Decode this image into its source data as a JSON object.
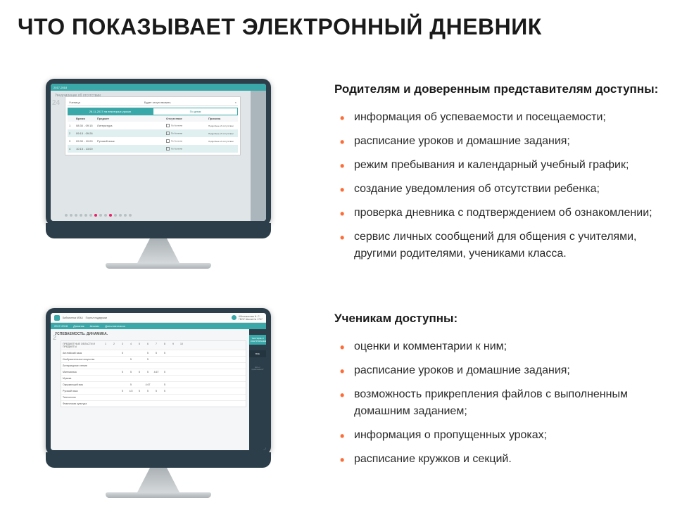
{
  "page_title": "ЧТО ПОКАЗЫВАЕТ ЭЛЕКТРОННЫЙ ДНЕВНИК",
  "section1": {
    "title": "Родителям и доверенным представителям доступны:",
    "items": [
      "информация об успеваемости и посещаемости;",
      "расписание уроков и домашние задания;",
      "режим пребывания и календарный учебный график;",
      "создание уведомления об отсутствии ребенка;",
      "проверка дневника с подтверждением об ознакомлении;",
      "сервис личных сообщений для общения с учителями, другими родителями, учениками класса."
    ],
    "app": {
      "year": "2017-2018",
      "bg_title": "Уведомление об отсутствии",
      "bg_num": "24",
      "modal_left": "Ученица",
      "modal_right": "Будет отсутствовать",
      "tab_active": "28.11.2017 на некоторых уроках",
      "tab_inactive": "По дням",
      "thead": [
        "",
        "Время",
        "Предмет",
        "Отсутствие",
        "Причина"
      ],
      "rows": [
        {
          "n": "1",
          "time": "08:30 - 09:15",
          "subj": "Литература",
          "cause": "Подробнее об отсутствии"
        },
        {
          "n": "2",
          "time": "09:15 - 09:26",
          "subj": "",
          "cause": "Подробнее об отсутствии"
        },
        {
          "n": "3",
          "time": "09:30 - 10:00",
          "subj": "Русский язык",
          "cause": "Подробнее об отсутствии"
        },
        {
          "n": "4",
          "time": "10:15 - 13:00",
          "subj": "",
          "cause": ""
        }
      ]
    }
  },
  "section2": {
    "title": "Ученикам доступны:",
    "items": [
      "оценки и комментарии к ним;",
      "расписание уроков и домашние задания;",
      "возможность прикрепления файлов с выполненным домашним заданием;",
      "информация о пропущенных уроках;",
      "расписание кружков и секций."
    ],
    "app": {
      "year": "2017-2018",
      "site": "Библиотека МЭШ",
      "support": "Портал поддержки",
      "user_name": "Абельмасова Н. С.",
      "user_school": "ГБОУ Школа № 1747",
      "nav": [
        "Дневник",
        "Анализ",
        "Дополнительно"
      ],
      "title": "УСПЕВАЕМОСТЬ. ДИНАМИКА.",
      "bg_num": "2",
      "col_label": "динамика по неделям",
      "first_col": "ПРЕДМЕТНЫЕ ОБЛАСТИ И ПРЕДМЕТЫ",
      "cols": [
        "1",
        "2",
        "3",
        "4",
        "5",
        "6",
        "7",
        "8",
        "9",
        "10"
      ],
      "sidebar_label1": "ТЕКУЩИЕ И КОНТРОЛЬНЫЕ",
      "sidebar_label2": "ВСЕ",
      "sidebar_label3": "Есть с примечанием?",
      "rows": [
        {
          "name": "Английский язык",
          "vals": [
            "",
            "",
            "5",
            "",
            "",
            "5",
            "5",
            "5",
            ""
          ]
        },
        {
          "name": "Изобразительное искусство",
          "vals": [
            "",
            "",
            "",
            "5",
            "",
            "5",
            "",
            "",
            ""
          ]
        },
        {
          "name": "Литературное чтение",
          "vals": [
            "",
            "",
            "",
            "",
            "",
            "",
            "",
            "",
            ""
          ]
        },
        {
          "name": "Математика",
          "vals": [
            "",
            "",
            "5",
            "5",
            "5",
            "5",
            "4.67",
            "5",
            ""
          ]
        },
        {
          "name": "Музыка",
          "vals": [
            "",
            "",
            "",
            "",
            "",
            "",
            "",
            "",
            ""
          ]
        },
        {
          "name": "Окружающий мир",
          "vals": [
            "",
            "",
            "",
            "5",
            "",
            "4.67",
            "",
            "5",
            ""
          ]
        },
        {
          "name": "Русский язык",
          "vals": [
            "",
            "",
            "5",
            "4.5",
            "5",
            "5",
            "5",
            "5",
            ""
          ]
        },
        {
          "name": "Технология",
          "vals": [
            "",
            "",
            "",
            "",
            "",
            "",
            "",
            "",
            ""
          ]
        },
        {
          "name": "Физическая культура",
          "vals": [
            "",
            "",
            "",
            "",
            "",
            "",
            "",
            "",
            ""
          ]
        }
      ]
    }
  }
}
